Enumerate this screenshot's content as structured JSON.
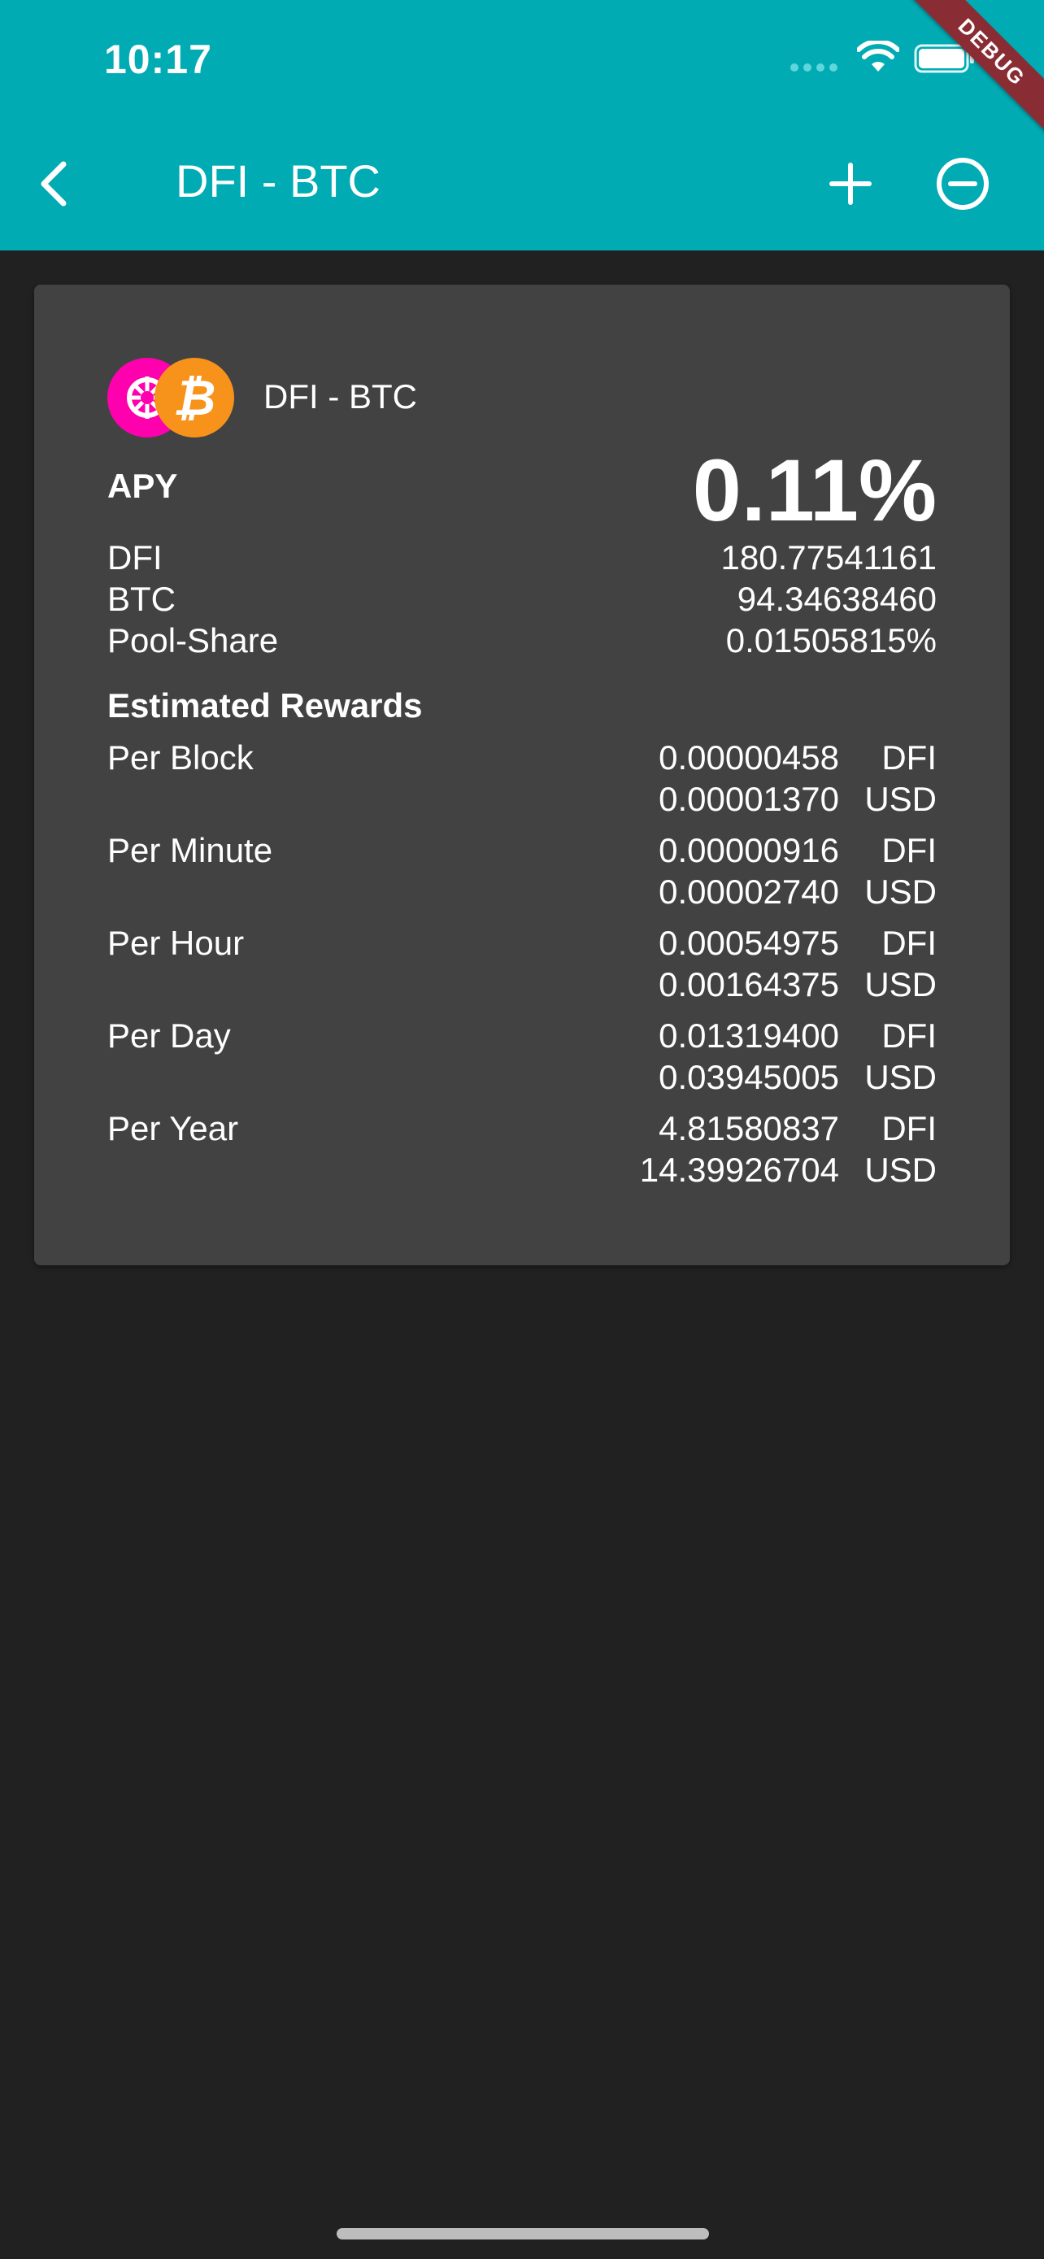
{
  "status_bar": {
    "time": "10:17"
  },
  "debug_banner": "DEBUG",
  "app_bar": {
    "title": "DFI - BTC"
  },
  "card": {
    "pair_name": "DFI - BTC",
    "apy_label": "APY",
    "apy_value": "0.11%",
    "rows": [
      {
        "label": "DFI",
        "value": "180.77541161"
      },
      {
        "label": "BTC",
        "value": "94.34638460"
      },
      {
        "label": "Pool-Share",
        "value": "0.01505815%"
      }
    ],
    "rewards_title": "Estimated Rewards",
    "rewards": [
      {
        "label": "Per Block",
        "dfi": "0.00000458",
        "usd": "0.00001370"
      },
      {
        "label": "Per Minute",
        "dfi": "0.00000916",
        "usd": "0.00002740"
      },
      {
        "label": "Per Hour",
        "dfi": "0.00054975",
        "usd": "0.00164375"
      },
      {
        "label": "Per Day",
        "dfi": "0.01319400",
        "usd": "0.03945005"
      },
      {
        "label": "Per Year",
        "dfi": "4.81580837",
        "usd": "14.39926704"
      }
    ],
    "unit_dfi": "DFI",
    "unit_usd": "USD"
  },
  "colors": {
    "app_bar": "#00abb4",
    "background": "#212121",
    "card": "#424242",
    "dfi_brand": "#ff00af",
    "btc_brand": "#f7931a",
    "debug_ribbon": "#8a2c34"
  },
  "icons": [
    "back-chevron-icon",
    "plus-icon",
    "minus-circle-icon",
    "wifi-icon",
    "battery-icon",
    "dfi-token-icon",
    "btc-token-icon"
  ]
}
